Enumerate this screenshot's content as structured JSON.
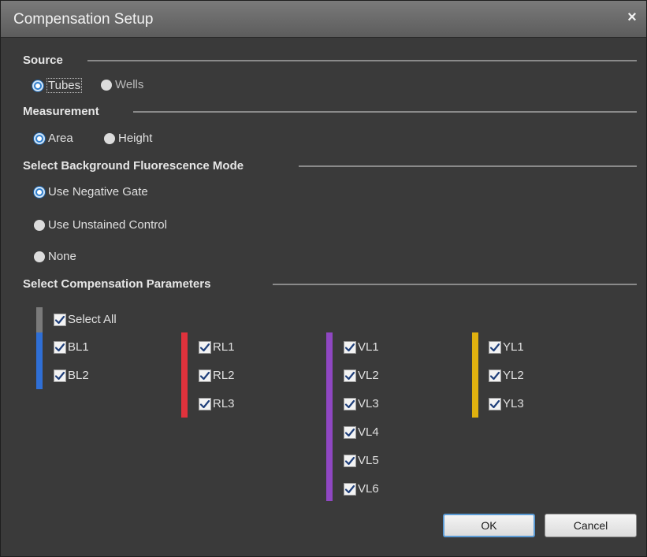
{
  "window": {
    "title": "Compensation Setup",
    "close_glyph": "×"
  },
  "source": {
    "heading": "Source",
    "options": [
      {
        "label": "Tubes",
        "selected": true
      },
      {
        "label": "Wells",
        "selected": false
      }
    ]
  },
  "measurement": {
    "heading": "Measurement",
    "options": [
      {
        "label": "Area",
        "selected": true
      },
      {
        "label": "Height",
        "selected": false
      }
    ]
  },
  "background": {
    "heading": "Select Background Fluorescence Mode",
    "options": [
      {
        "label": "Use Negative Gate",
        "selected": true
      },
      {
        "label": "Use Unstained Control",
        "selected": false
      },
      {
        "label": "None",
        "selected": false
      }
    ]
  },
  "parameters": {
    "heading": "Select Compensation Parameters",
    "select_all": {
      "label": "Select All",
      "checked": true
    },
    "groups": [
      {
        "color": "#2f6fd6",
        "items": [
          {
            "label": "BL1",
            "checked": true
          },
          {
            "label": "BL2",
            "checked": true
          }
        ]
      },
      {
        "color": "#e0323c",
        "items": [
          {
            "label": "RL1",
            "checked": true
          },
          {
            "label": "RL2",
            "checked": true
          },
          {
            "label": "RL3",
            "checked": true
          }
        ]
      },
      {
        "color": "#8f47c2",
        "items": [
          {
            "label": "VL1",
            "checked": true
          },
          {
            "label": "VL2",
            "checked": true
          },
          {
            "label": "VL3",
            "checked": true
          },
          {
            "label": "VL4",
            "checked": true
          },
          {
            "label": "VL5",
            "checked": true
          },
          {
            "label": "VL6",
            "checked": true
          }
        ]
      },
      {
        "color": "#e0b10f",
        "items": [
          {
            "label": "YL1",
            "checked": true
          },
          {
            "label": "YL2",
            "checked": true
          },
          {
            "label": "YL3",
            "checked": true
          }
        ]
      }
    ],
    "select_all_color": "#7a7a7a"
  },
  "buttons": {
    "ok": "OK",
    "cancel": "Cancel"
  },
  "colors": {
    "radio_selected": "#2f7fcf",
    "dialog_bg": "#3a3a3a"
  }
}
